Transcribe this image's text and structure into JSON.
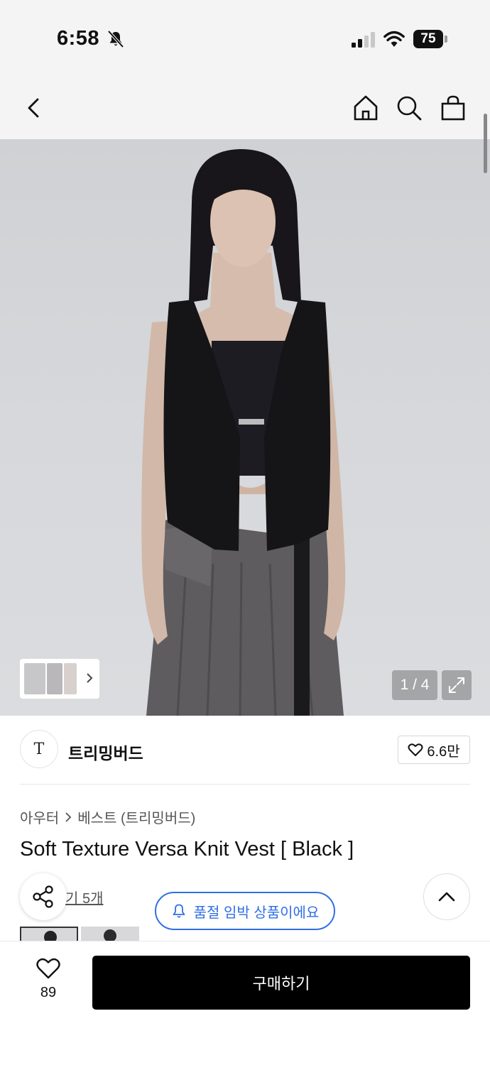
{
  "status_bar": {
    "time": "6:58",
    "battery": "75"
  },
  "colors": {
    "accent": "#2f6fe6",
    "buy_bg": "#000000"
  },
  "hero": {
    "page_indicator": "1 / 4"
  },
  "brand": {
    "logo": "T",
    "name": "트리밍버드",
    "likes": "6.6만"
  },
  "product": {
    "category_parent": "아우터",
    "category_child": "베스트 (트리밍버드)",
    "title": "Soft Texture Versa Knit Vest [ Black ]",
    "review_link": "기 5개"
  },
  "badge": {
    "text": "품절 임박 상품이에요"
  },
  "bottom_bar": {
    "wish_count": "89",
    "buy_label": "구매하기"
  },
  "icons": [
    "mute-icon",
    "signal-icon",
    "wifi-icon",
    "back-icon",
    "home-icon",
    "search-icon",
    "cart-icon",
    "expand-icon",
    "heart-icon",
    "chevron-right-icon",
    "share-icon",
    "chevron-up-icon",
    "bell-icon"
  ]
}
